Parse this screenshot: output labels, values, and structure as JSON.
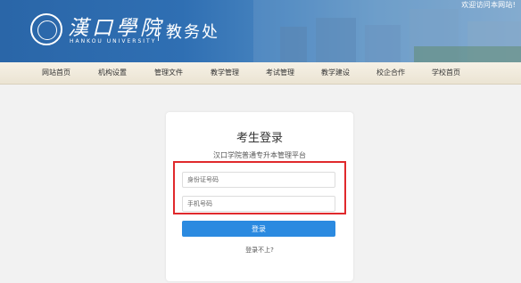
{
  "header": {
    "welcome": "欢迎访问本网站!",
    "logo_cn": "漢口學院",
    "logo_en": "HANKOU UNIVERSITY",
    "department": "教务处"
  },
  "nav": {
    "items": [
      "网站首页",
      "机构设置",
      "管理文件",
      "教学管理",
      "考试管理",
      "教学建设",
      "校企合作",
      "学校首页"
    ]
  },
  "login": {
    "title": "考生登录",
    "subtitle": "汉口学院普通专升本管理平台",
    "id_placeholder": "身份证号码",
    "phone_placeholder": "手机号码",
    "submit_label": "登录",
    "help_link": "登录不上?"
  },
  "colors": {
    "header_blue": "#2f6fb3",
    "button_blue": "#2b8ae0",
    "highlight_red": "#e0292c"
  }
}
